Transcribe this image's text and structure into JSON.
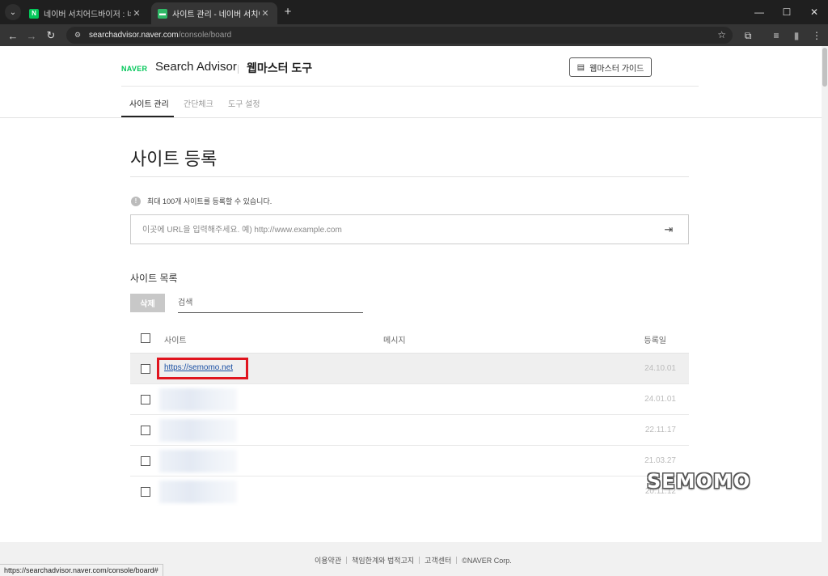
{
  "browser": {
    "tabs": [
      {
        "title": "네이버 서치어드바이저 : 네이버",
        "favicon": "N",
        "active": false
      },
      {
        "title": "사이트 관리 - 네이버 서치어드",
        "active": true
      }
    ],
    "url_host": "searchadvisor.naver.com",
    "url_path": "/console/board",
    "status_url": "https://searchadvisor.naver.com/console/board#"
  },
  "header": {
    "logo": "NAVER",
    "brand": "Search Advisor",
    "subtitle": "웹마스터 도구",
    "guide_button": "웹마스터 가이드"
  },
  "subnav": [
    "사이트 관리",
    "간단체크",
    "도구 설정"
  ],
  "main": {
    "title": "사이트 등록",
    "notice": "최대 100개 사이트를 등록할 수 있습니다.",
    "url_placeholder": "이곳에 URL을 입력해주세요. 예) http://www.example.com",
    "list_title": "사이트 목록",
    "delete_button": "삭제",
    "search_placeholder": "검색",
    "table": {
      "headers": {
        "site": "사이트",
        "message": "메시지",
        "date": "등록일"
      },
      "rows": [
        {
          "site": "https://semomo.net",
          "date": "24.10.01"
        },
        {
          "site": "",
          "date": "24.01.01"
        },
        {
          "site": "",
          "date": "22.11.17"
        },
        {
          "site": "",
          "date": "21.03.27"
        },
        {
          "site": "",
          "date": "20.11.12"
        }
      ]
    }
  },
  "watermark": "SEMOMO",
  "footer": [
    "이용약관",
    "책임한계와 법적고지",
    "고객센터",
    "©NAVER Corp."
  ],
  "colors": {
    "naver_green": "#03c75a",
    "highlight_red": "#e0141e",
    "link_blue": "#1a4fa3"
  }
}
